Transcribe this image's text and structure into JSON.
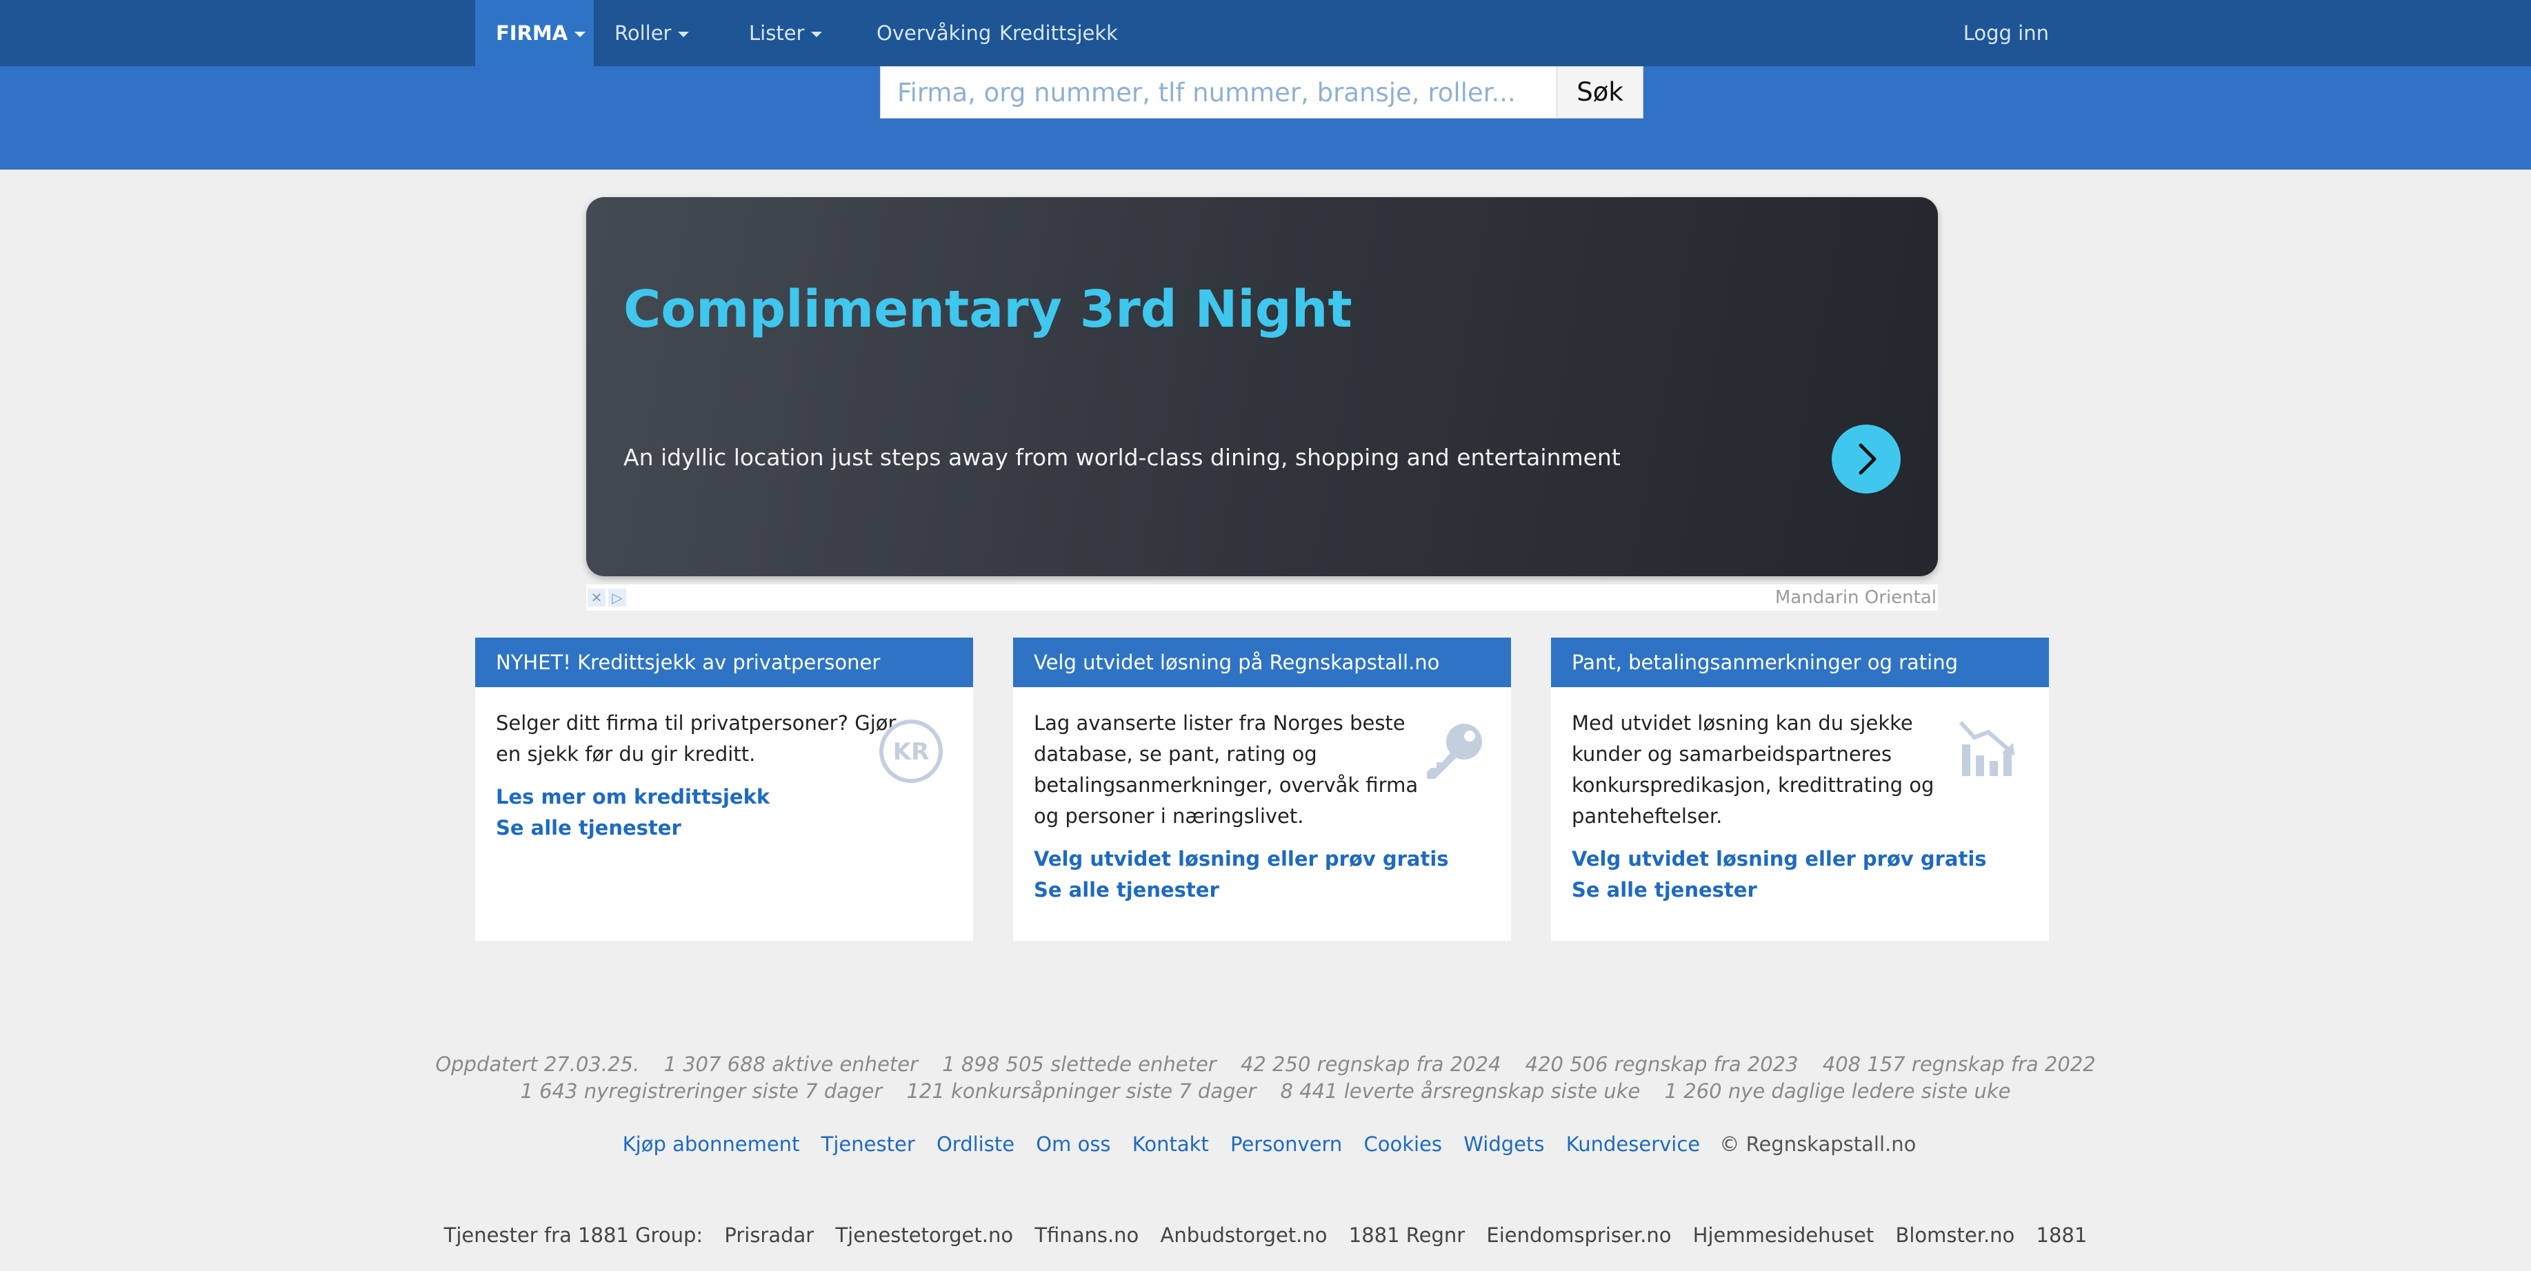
{
  "nav": {
    "items": [
      {
        "label": "FIRMA",
        "active": true,
        "dropdown": true
      },
      {
        "label": "Roller",
        "dropdown": true
      },
      {
        "label": "Lister",
        "dropdown": true
      },
      {
        "label": "Overvåking"
      },
      {
        "label": "Kredittsjekk"
      }
    ],
    "login": "Logg inn"
  },
  "search": {
    "placeholder": "Firma, org nummer, tlf nummer, bransje, roller...",
    "button": "Søk"
  },
  "ad": {
    "title": "Complimentary 3rd Night",
    "text": "An idyllic location just steps away from world-class dining, shopping and entertainment",
    "advertiser": "Mandarin Oriental",
    "accent": "#3fc7ee"
  },
  "cards": [
    {
      "title": "NYHET! Kredittsjekk av privatpersoner",
      "lines": [
        "Selger ditt firma til privatpersoner? Gjør",
        "en sjekk før du gir kreditt."
      ],
      "links": [
        "Les mer om kredittsjekk",
        "Se alle tjenester"
      ],
      "icon": "kr-coin-icon",
      "icon_text": "KR"
    },
    {
      "title": "Velg utvidet løsning på Regnskapstall.no",
      "lines": [
        "Lag avanserte lister fra Norges beste",
        "database, se pant, rating og",
        "betalingsanmerkninger, overvåk firma",
        "og personer i næringslivet."
      ],
      "links": [
        "Velg utvidet løsning eller prøv gratis",
        "Se alle tjenester"
      ],
      "icon": "key-icon"
    },
    {
      "title": "Pant, betalingsanmerkninger og rating",
      "lines": [
        "Med utvidet løsning kan du sjekke",
        "kunder og samarbeidspartneres",
        "konkurspredikasjon, kredittrating og",
        "panteheftelser."
      ],
      "links": [
        "Velg utvidet løsning eller prøv gratis",
        "Se alle tjenester"
      ],
      "icon": "chart-decline-icon"
    }
  ],
  "stats": {
    "row1": [
      "Oppdatert 27.03.25.",
      "1 307 688 aktive enheter",
      "1 898 505 slettede enheter",
      "42 250 regnskap fra 2024",
      "420 506 regnskap fra 2023",
      "408 157 regnskap fra 2022"
    ],
    "row2": [
      "1 643 nyregistreringer siste 7 dager",
      "121 konkursåpninger siste 7 dager",
      "8 441 leverte årsregnskap siste uke",
      "1 260 nye daglige ledere siste uke"
    ]
  },
  "footer": {
    "links": [
      "Kjøp abonnement",
      "Tjenester",
      "Ordliste",
      "Om oss",
      "Kontakt",
      "Personvern",
      "Cookies",
      "Widgets",
      "Kundeservice"
    ],
    "copyright": "© Regnskapstall.no"
  },
  "group": {
    "label": "Tjenester fra 1881 Group:",
    "items": [
      "Prisradar",
      "Tjenestetorget.no",
      "Tfinans.no",
      "Anbudstorget.no",
      "1881 Regnr",
      "Eiendomspriser.no",
      "Hjemmesidehuset",
      "Blomster.no",
      "1881"
    ]
  },
  "colors": {
    "nav_bg": "#1d5595",
    "band_bg": "#3272c6",
    "card_head": "#2f74c4",
    "link": "#1e6ac0"
  }
}
